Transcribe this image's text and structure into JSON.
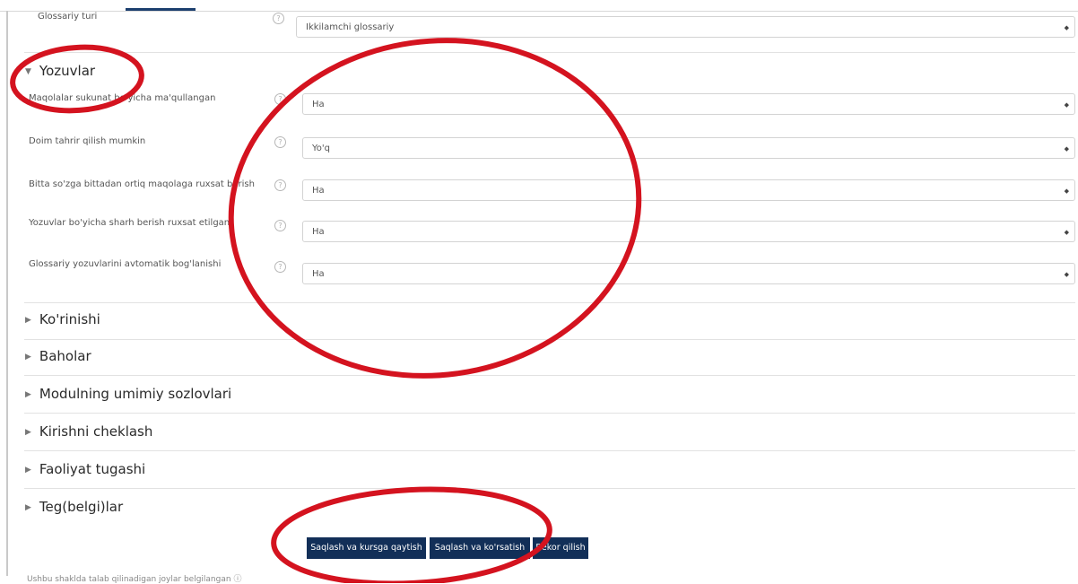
{
  "glossary_type": {
    "label": "Glossariy turi",
    "value": "Ikkilamchi glossariy"
  },
  "sections": {
    "yozuvlar": "Yozuvlar",
    "korinishi": "Ko'rinishi",
    "baholar": "Baholar",
    "modul": "Modulning umimiy sozlovlari",
    "kirish": "Kirishni cheklash",
    "faoliyat": "Faoliyat tugashi",
    "teg": "Teg(belgi)lar"
  },
  "fields": [
    {
      "label": "Maqolalar sukunat bo'yicha ma'qullangan",
      "value": "Ha"
    },
    {
      "label": "Doim tahrir qilish mumkin",
      "value": "Yo'q"
    },
    {
      "label": "Bitta so'zga bittadan ortiq maqolaga ruxsat berish",
      "value": "Ha"
    },
    {
      "label": "Yozuvlar bo'yicha sharh berish ruxsat etilgan",
      "value": "Ha"
    },
    {
      "label": "Glossariy yozuvlarini avtomatik bog'lanishi",
      "value": "Ha"
    }
  ],
  "buttons": {
    "save_return": "Saqlash va kursga qaytish",
    "save_show": "Saqlash va ko'rsatish",
    "cancel": "Bekor qilish"
  },
  "footnote": "Ushbu shaklda talab qilinadigan joylar belgilangan",
  "icons": {
    "help": "question-circle-icon",
    "expanded": "caret-down-icon",
    "collapsed": "caret-right-icon"
  },
  "colors": {
    "primary_button": "#122f58",
    "annotation": "#d4131f"
  }
}
